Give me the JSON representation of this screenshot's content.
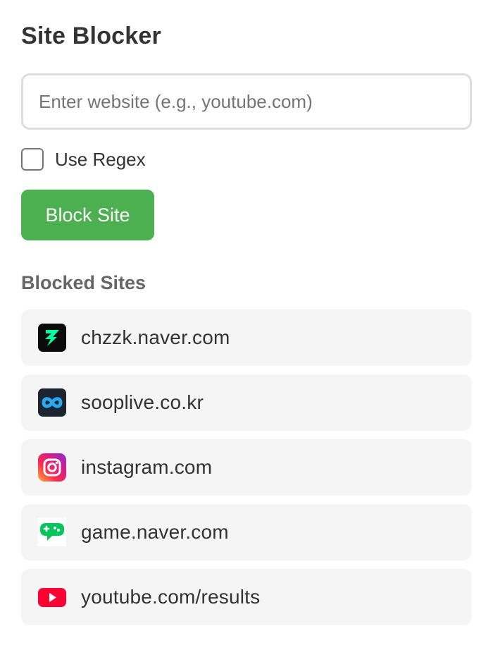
{
  "title": "Site Blocker",
  "input": {
    "placeholder": "Enter website (e.g., youtube.com)",
    "value": ""
  },
  "regex": {
    "label": "Use Regex",
    "checked": false
  },
  "block_button_label": "Block Site",
  "blocked_title": "Blocked Sites",
  "blocked_sites": [
    {
      "label": "chzzk.naver.com",
      "icon": "chzzk-icon"
    },
    {
      "label": "sooplive.co.kr",
      "icon": "sooplive-icon"
    },
    {
      "label": "instagram.com",
      "icon": "instagram-icon"
    },
    {
      "label": "game.naver.com",
      "icon": "naver-game-icon"
    },
    {
      "label": "youtube.com/results",
      "icon": "youtube-icon"
    }
  ],
  "colors": {
    "accent": "#4caf50",
    "item_background": "#f5f5f5",
    "title": "#333333",
    "section_title": "#666666"
  }
}
